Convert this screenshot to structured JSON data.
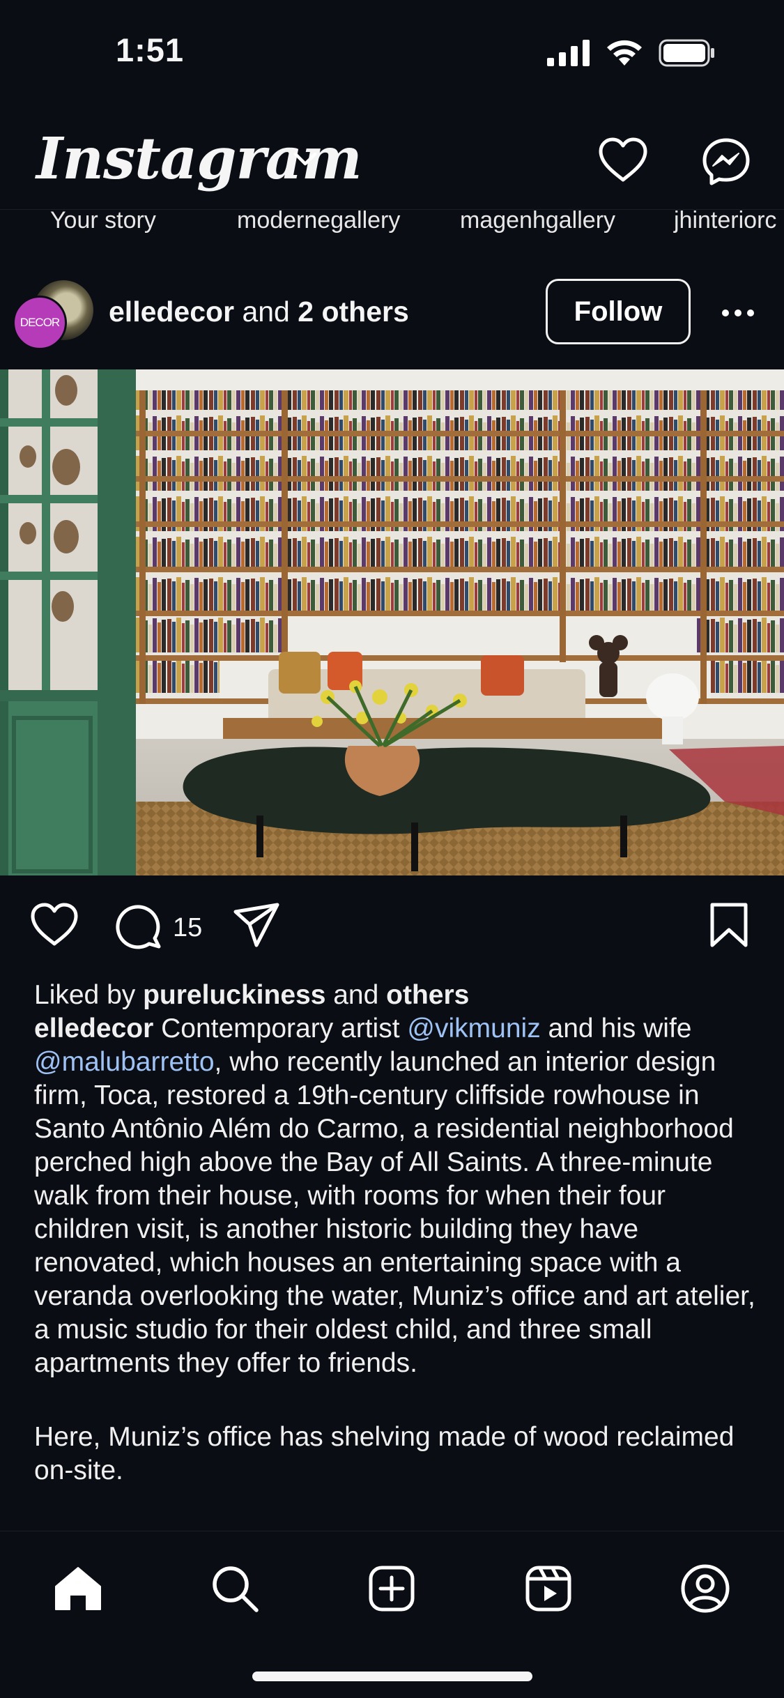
{
  "status_bar": {
    "time": "1:51",
    "icons": [
      "cellular-signal-icon",
      "wifi-icon",
      "battery-icon"
    ]
  },
  "top_nav": {
    "logo": "Instagram",
    "icons": [
      "chevron-down-icon",
      "heart-icon",
      "messenger-icon"
    ]
  },
  "stories": [
    {
      "label": "Your story"
    },
    {
      "label": "modernegallery"
    },
    {
      "label": "magenhgallery"
    },
    {
      "label": "jhinteriorc"
    }
  ],
  "post": {
    "avatar_text": "DECOR",
    "author": "elledecor",
    "author_joiner": "and",
    "others": "2 others",
    "follow_label": "Follow",
    "comment_count": "15",
    "liked_by_prefix": "Liked by",
    "liked_by_user": "pureluckiness",
    "liked_by_joiner": "and",
    "liked_by_others": "others",
    "caption_author": "elledecor",
    "caption_part1": "Contemporary artist",
    "mention1": "@vikmuniz",
    "caption_part2": "and his wife",
    "mention2": "@malubarretto",
    "caption_part3": ", who recently launched an interior design firm, Toca, restored a 19th-century cliffside rowhouse in Santo Antônio Além do Carmo, a residential neighborhood perched high above the Bay of All Saints. A three-minute walk from their house, with rooms for when their four children visit, is another historic building they have renovated, which houses an entertaining space with a veranda overlooking the water, Muniz’s office and art atelier, a music studio for their oldest child, and three small apartments they offer to friends.",
    "caption_para2": "Here, Muniz’s office has shelving made of wood reclaimed on-site."
  },
  "bottom_nav": {
    "items": [
      "home-icon",
      "search-icon",
      "create-post-icon",
      "reels-icon",
      "profile-icon"
    ]
  },
  "colors": {
    "background": "#0b0d14",
    "mention": "#9fc2f4",
    "avatar_magenta": "#b53bb9",
    "door_green": "#3f7d5e"
  }
}
